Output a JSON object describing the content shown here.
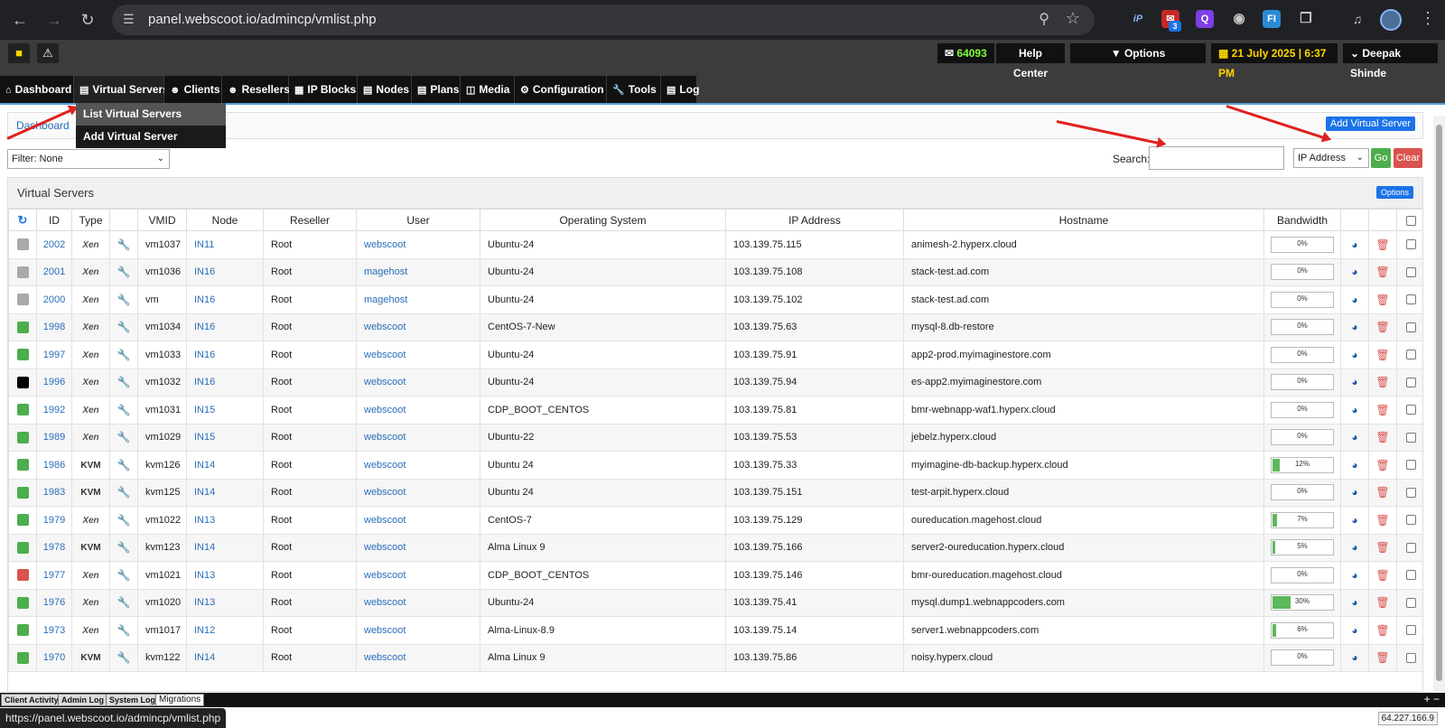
{
  "browser": {
    "url": "panel.webscoot.io/admincp/vmlist.php",
    "ext_badge": "3",
    "icons": [
      "back-icon",
      "forward-icon",
      "reload-icon",
      "site-info-icon",
      "zoom-icon",
      "bookmark-star-icon"
    ]
  },
  "top": {
    "mail_count": "64093",
    "help_center": "Help Center",
    "options": "Options",
    "date": "21 July 2025 | 6:37 PM",
    "user": "Deepak Shinde"
  },
  "menu": [
    {
      "label": "Dashboard",
      "icon": "home-icon"
    },
    {
      "label": "Virtual Servers",
      "icon": "server-icon"
    },
    {
      "label": "Clients",
      "icon": "users-icon"
    },
    {
      "label": "Resellers",
      "icon": "user-icon"
    },
    {
      "label": "IP Blocks",
      "icon": "grid-icon"
    },
    {
      "label": "Nodes",
      "icon": "server-icon"
    },
    {
      "label": "Plans",
      "icon": "list-icon"
    },
    {
      "label": "Media",
      "icon": "file-icon"
    },
    {
      "label": "Configuration",
      "icon": "gear-icon"
    },
    {
      "label": "Tools",
      "icon": "wrench-icon"
    },
    {
      "label": "Log",
      "icon": "list-icon"
    }
  ],
  "dropdown": [
    "List Virtual Servers",
    "Add Virtual Server"
  ],
  "breadcrumb": "Dashboard",
  "add_vs": "Add Virtual Server",
  "filter": "Filter: None",
  "search": {
    "label": "Search:",
    "field": "IP Address",
    "go": "Go",
    "clear": "Clear"
  },
  "panel": {
    "title": "Virtual Servers",
    "options": "Options"
  },
  "columns": [
    "ID",
    "Type",
    "VMID",
    "Node",
    "Reseller",
    "User",
    "Operating System",
    "IP Address",
    "Hostname",
    "Bandwidth"
  ],
  "rows": [
    {
      "status": "#a9a9a9",
      "id": "2002",
      "type": "Xen",
      "vmid": "vm1037",
      "node": "IN11",
      "reseller": "Root",
      "user": "webscoot",
      "os": "Ubuntu-24",
      "ip": "103.139.75.115",
      "host": "animesh-2.hyperx.cloud",
      "bw": "0%",
      "bw_frac": 0
    },
    {
      "status": "#a9a9a9",
      "id": "2001",
      "type": "Xen",
      "vmid": "vm1036",
      "node": "IN16",
      "reseller": "Root",
      "user": "magehost",
      "os": "Ubuntu-24",
      "ip": "103.139.75.108",
      "host": "stack-test.ad.com",
      "bw": "0%",
      "bw_frac": 0
    },
    {
      "status": "#a9a9a9",
      "id": "2000",
      "type": "Xen",
      "vmid": "vm",
      "node": "IN16",
      "reseller": "Root",
      "user": "magehost",
      "os": "Ubuntu-24",
      "ip": "103.139.75.102",
      "host": "stack-test.ad.com",
      "bw": "0%",
      "bw_frac": 0
    },
    {
      "status": "#4cae4c",
      "id": "1998",
      "type": "Xen",
      "vmid": "vm1034",
      "node": "IN16",
      "reseller": "Root",
      "user": "webscoot",
      "os": "CentOS-7-New",
      "ip": "103.139.75.63",
      "host": "mysql-8.db-restore",
      "bw": "0%",
      "bw_frac": 0
    },
    {
      "status": "#4cae4c",
      "id": "1997",
      "type": "Xen",
      "vmid": "vm1033",
      "node": "IN16",
      "reseller": "Root",
      "user": "webscoot",
      "os": "Ubuntu-24",
      "ip": "103.139.75.91",
      "host": "app2-prod.myimaginestore.com",
      "bw": "0%",
      "bw_frac": 0
    },
    {
      "status": "#000000",
      "id": "1996",
      "type": "Xen",
      "vmid": "vm1032",
      "node": "IN16",
      "reseller": "Root",
      "user": "webscoot",
      "os": "Ubuntu-24",
      "ip": "103.139.75.94",
      "host": "es-app2.myimaginestore.com",
      "bw": "0%",
      "bw_frac": 0
    },
    {
      "status": "#4cae4c",
      "id": "1992",
      "type": "Xen",
      "vmid": "vm1031",
      "node": "IN15",
      "reseller": "Root",
      "user": "webscoot",
      "os": "CDP_BOOT_CENTOS",
      "ip": "103.139.75.81",
      "host": "bmr-webnapp-waf1.hyperx.cloud",
      "bw": "0%",
      "bw_frac": 0
    },
    {
      "status": "#4cae4c",
      "id": "1989",
      "type": "Xen",
      "vmid": "vm1029",
      "node": "IN15",
      "reseller": "Root",
      "user": "webscoot",
      "os": "Ubuntu-22",
      "ip": "103.139.75.53",
      "host": "jebelz.hyperx.cloud",
      "bw": "0%",
      "bw_frac": 0
    },
    {
      "status": "#4cae4c",
      "id": "1986",
      "type": "KVM",
      "vmid": "kvm126",
      "node": "IN14",
      "reseller": "Root",
      "user": "webscoot",
      "os": "Ubuntu 24",
      "ip": "103.139.75.33",
      "host": "myimagine-db-backup.hyperx.cloud",
      "bw": "12%",
      "bw_frac": 0.12
    },
    {
      "status": "#4cae4c",
      "id": "1983",
      "type": "KVM",
      "vmid": "kvm125",
      "node": "IN14",
      "reseller": "Root",
      "user": "webscoot",
      "os": "Ubuntu 24",
      "ip": "103.139.75.151",
      "host": "test-arpit.hyperx.cloud",
      "bw": "0%",
      "bw_frac": 0
    },
    {
      "status": "#4cae4c",
      "id": "1979",
      "type": "Xen",
      "vmid": "vm1022",
      "node": "IN13",
      "reseller": "Root",
      "user": "webscoot",
      "os": "CentOS-7",
      "ip": "103.139.75.129",
      "host": "oureducation.magehost.cloud",
      "bw": "7%",
      "bw_frac": 0.07
    },
    {
      "status": "#4cae4c",
      "id": "1978",
      "type": "KVM",
      "vmid": "kvm123",
      "node": "IN14",
      "reseller": "Root",
      "user": "webscoot",
      "os": "Alma Linux 9",
      "ip": "103.139.75.166",
      "host": "server2-oureducation.hyperx.cloud",
      "bw": "5%",
      "bw_frac": 0.05
    },
    {
      "status": "#d9534f",
      "id": "1977",
      "type": "Xen",
      "vmid": "vm1021",
      "node": "IN13",
      "reseller": "Root",
      "user": "webscoot",
      "os": "CDP_BOOT_CENTOS",
      "ip": "103.139.75.146",
      "host": "bmr-oureducation.magehost.cloud",
      "bw": "0%",
      "bw_frac": 0
    },
    {
      "status": "#4cae4c",
      "id": "1976",
      "type": "Xen",
      "vmid": "vm1020",
      "node": "IN13",
      "reseller": "Root",
      "user": "webscoot",
      "os": "Ubuntu-24",
      "ip": "103.139.75.41",
      "host": "mysql.dump1.webnappcoders.com",
      "bw": "30%",
      "bw_frac": 0.3
    },
    {
      "status": "#4cae4c",
      "id": "1973",
      "type": "Xen",
      "vmid": "vm1017",
      "node": "IN12",
      "reseller": "Root",
      "user": "webscoot",
      "os": "Alma-Linux-8.9",
      "ip": "103.139.75.14",
      "host": "server1.webnappcoders.com",
      "bw": "6%",
      "bw_frac": 0.06
    },
    {
      "status": "#4cae4c",
      "id": "1970",
      "type": "KVM",
      "vmid": "kvm122",
      "node": "IN14",
      "reseller": "Root",
      "user": "webscoot",
      "os": "Alma Linux 9",
      "ip": "103.139.75.86",
      "host": "noisy.hyperx.cloud",
      "bw": "0%",
      "bw_frac": 0
    }
  ],
  "logtabs": [
    "Client Activity",
    "Admin Log",
    "System Log",
    "Migrations"
  ],
  "status_url": "https://panel.webscoot.io/admincp/vmlist.php",
  "ip_addr": "64.227.166.9"
}
